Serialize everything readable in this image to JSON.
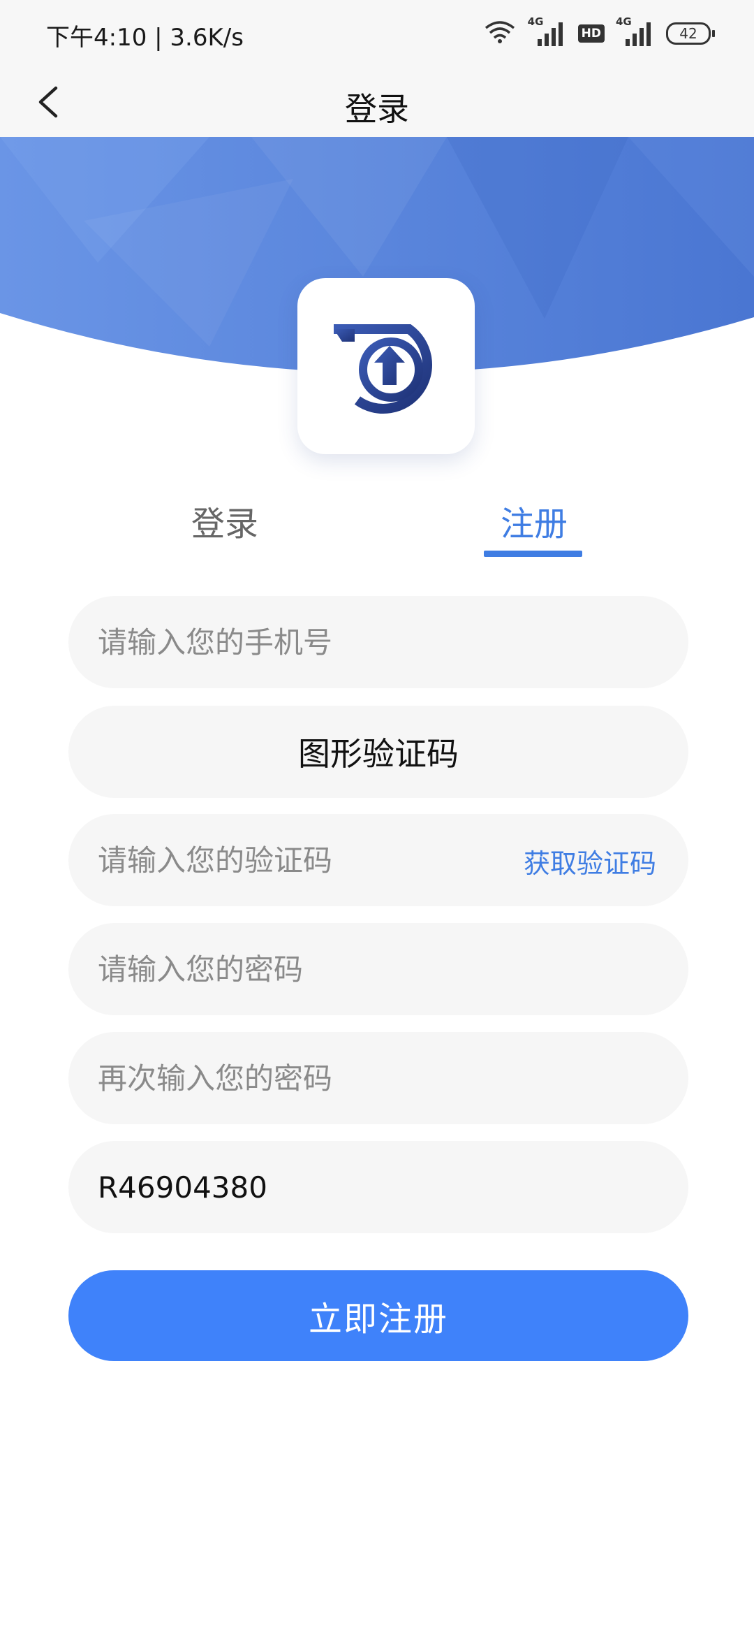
{
  "status": {
    "time": "下午4:10 | 3.6K/s",
    "network1": "4G",
    "hd": "HD",
    "network2": "4G",
    "battery": "42"
  },
  "nav": {
    "title": "登录"
  },
  "tabs": [
    {
      "label": "登录",
      "active": false
    },
    {
      "label": "注册",
      "active": true
    }
  ],
  "form": {
    "phone_placeholder": "请输入您的手机号",
    "captcha_label": "图形验证码",
    "code_placeholder": "请输入您的验证码",
    "get_code": "获取验证码",
    "password_placeholder": "请输入您的密码",
    "password_confirm_placeholder": "再次输入您的密码",
    "invite_value": "R46904380",
    "submit": "立即注册"
  },
  "colors": {
    "accent": "#3f7de3",
    "button": "#3f82fa"
  }
}
